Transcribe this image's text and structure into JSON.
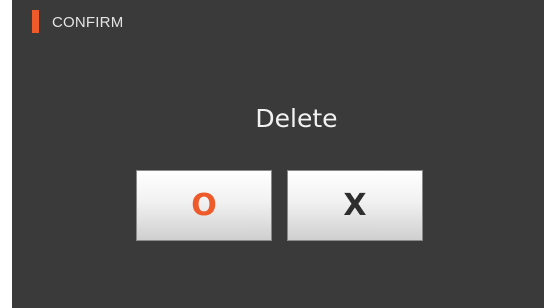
{
  "header": {
    "title": "CONFIRM",
    "accent_color": "#ee5a2a"
  },
  "dialog": {
    "message": "Delete",
    "confirm_label": "O",
    "cancel_label": "X"
  },
  "colors": {
    "background": "#3a3a3a",
    "confirm_text": "#ee5a2a",
    "cancel_text": "#2e2e2e"
  }
}
